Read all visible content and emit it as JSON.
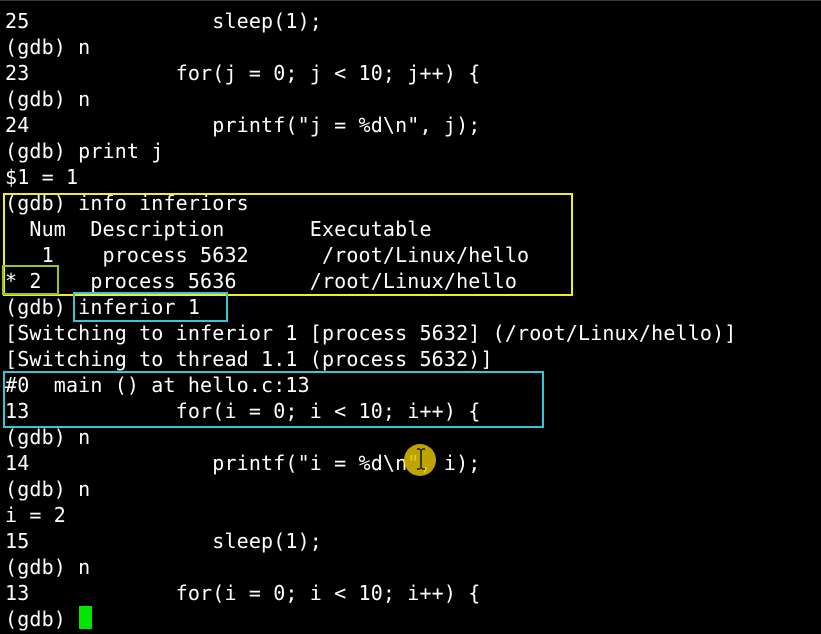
{
  "terminal": {
    "lines": [
      "25               sleep(1);",
      "(gdb) n",
      "23            for(j = 0; j < 10; j++) {",
      "(gdb) n",
      "24               printf(\"j = %d\\n\", j);",
      "(gdb) print j",
      "$1 = 1",
      "(gdb) info inferiors",
      "  Num  Description       Executable",
      "   1    process 5632      /root/Linux/hello",
      "* 2    process 5636      /root/Linux/hello",
      "(gdb) inferior 1",
      "[Switching to inferior 1 [process 5632] (/root/Linux/hello)]",
      "[Switching to thread 1.1 (process 5632)]",
      "#0  main () at hello.c:13",
      "13            for(i = 0; i < 10; i++) {",
      "(gdb) n",
      "14               printf(\"i = %d\\n\", i);",
      "(gdb) n",
      "i = 2",
      "15               sleep(1);",
      "(gdb) n",
      "13            for(i = 0; i < 10; i++) {",
      "(gdb) "
    ]
  },
  "colors": {
    "background": "#000000",
    "text": "#ffffff",
    "highlight_yellow": "#f2f01a",
    "highlight_green": "#9ac51e",
    "highlight_cyan": "#36c6d4",
    "cursor": "#00e600",
    "pointer_highlight": "#e0c000"
  },
  "icons": {
    "cursor": "block-cursor",
    "pointer": "ibeam-icon"
  }
}
